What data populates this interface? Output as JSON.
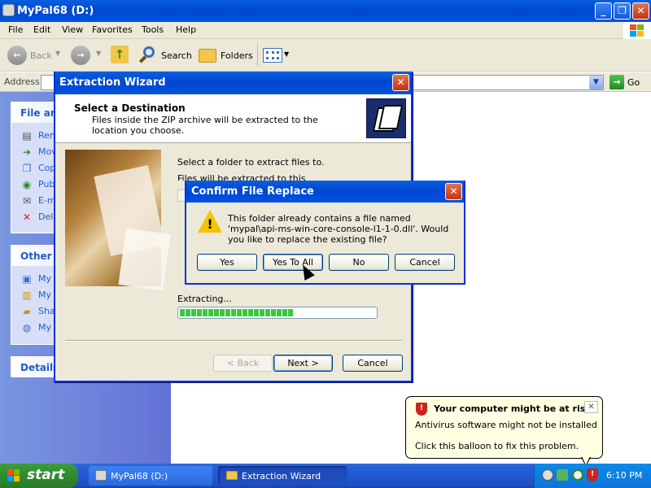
{
  "explorer": {
    "title": "MyPal68 (D:)",
    "menu": [
      "File",
      "Edit",
      "View",
      "Favorites",
      "Tools",
      "Help"
    ],
    "toolbar": {
      "back_label": "Back",
      "search_label": "Search",
      "folders_label": "Folders"
    },
    "address_label": "Address",
    "go_label": "Go",
    "taskpane": {
      "file_tasks_title": "File and",
      "file_tasks": [
        {
          "label": "Ren",
          "icon": "rename-icon"
        },
        {
          "label": "Mov",
          "icon": "move-icon"
        },
        {
          "label": "Cop",
          "icon": "copy-icon"
        },
        {
          "label": "Pub",
          "icon": "publish-icon"
        },
        {
          "label": "E-m",
          "icon": "email-icon"
        },
        {
          "label": "Dele",
          "icon": "delete-icon"
        }
      ],
      "other_places_title": "Other P",
      "other_places": [
        {
          "label": "My",
          "icon": "my-computer-icon"
        },
        {
          "label": "My",
          "icon": "my-documents-icon"
        },
        {
          "label": "Sha",
          "icon": "shared-folder-icon"
        },
        {
          "label": "My",
          "icon": "my-network-icon"
        }
      ],
      "details_title": "Details"
    }
  },
  "wizard": {
    "title": "Extraction Wizard",
    "heading": "Select a Destination",
    "subheading": "Files inside the ZIP archive will be extracted to the location you choose.",
    "select_label": "Select a folder to extract files to.",
    "files_label_partial": "Files will be extracted to this directory:",
    "extracting_label": "Extracting...",
    "progress_fraction": 0.6,
    "progress_segments": 20,
    "back_button": "< Back",
    "next_button": "Next >",
    "cancel_button": "Cancel"
  },
  "confirm": {
    "title": "Confirm File Replace",
    "message": "This folder already contains a file named 'mypal\\api-ms-win-core-console-l1-1-0.dll'.  Would you like to replace the existing file?",
    "yes_button": "Yes",
    "yes_to_all_button": "Yes To All",
    "no_button": "No",
    "cancel_button": "Cancel"
  },
  "taskbar": {
    "start_label": "start",
    "tasks": [
      {
        "label": "MyPal68 (D:)",
        "icon": "drive-icon"
      },
      {
        "label": "Extraction Wizard",
        "icon": "folder-icon"
      }
    ],
    "clock": "6:10 PM"
  },
  "balloon": {
    "title": "Your computer might be at risk",
    "line1": "Antivirus software might not be installed",
    "line2": "Click this balloon to fix this problem."
  },
  "colors": {
    "title_bar": "#0a5fe0",
    "taskbar": "#245edb",
    "start_button": "#2f8a2f",
    "progress_green": "#3cc83c",
    "balloon_bg": "#ffffe1"
  }
}
